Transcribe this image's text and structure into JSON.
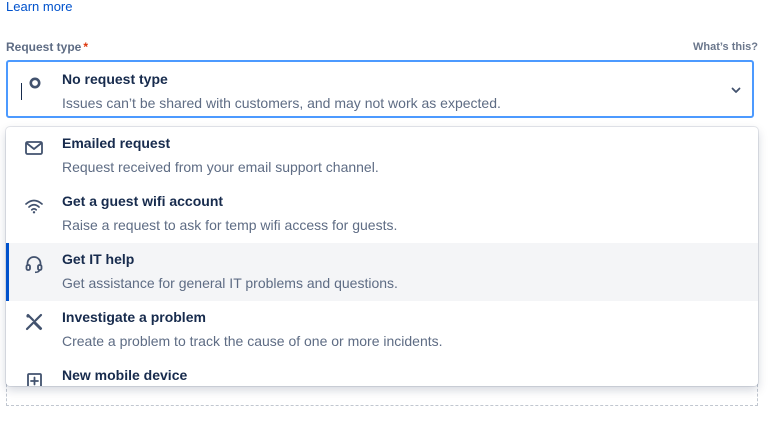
{
  "header": {
    "learn_more": "Learn more"
  },
  "field": {
    "label": "Request type",
    "required_mark": "*",
    "help": "What’s this?"
  },
  "selected": {
    "title": "No request type",
    "description": "Issues can’t be shared with customers, and may not work as expected.",
    "icon": "circle-icon"
  },
  "options": [
    {
      "title": "Emailed request",
      "description": "Request received from your email support channel.",
      "icon": "envelope-icon",
      "highlighted": false
    },
    {
      "title": "Get a guest wifi account",
      "description": "Raise a request to ask for temp wifi access for guests.",
      "icon": "wifi-icon",
      "highlighted": false
    },
    {
      "title": "Get IT help",
      "description": "Get assistance for general IT problems and questions.",
      "icon": "headset-icon",
      "highlighted": true
    },
    {
      "title": "Investigate a problem",
      "description": "Create a problem to track the cause of one or more incidents.",
      "icon": "tools-icon",
      "highlighted": false
    },
    {
      "title": "New mobile device",
      "description": "",
      "icon": "plus-box-icon",
      "highlighted": false
    }
  ],
  "colors": {
    "link": "#0052cc",
    "focus_border": "#4c9aff",
    "highlight_bar": "#0052cc",
    "required": "#de350b"
  }
}
